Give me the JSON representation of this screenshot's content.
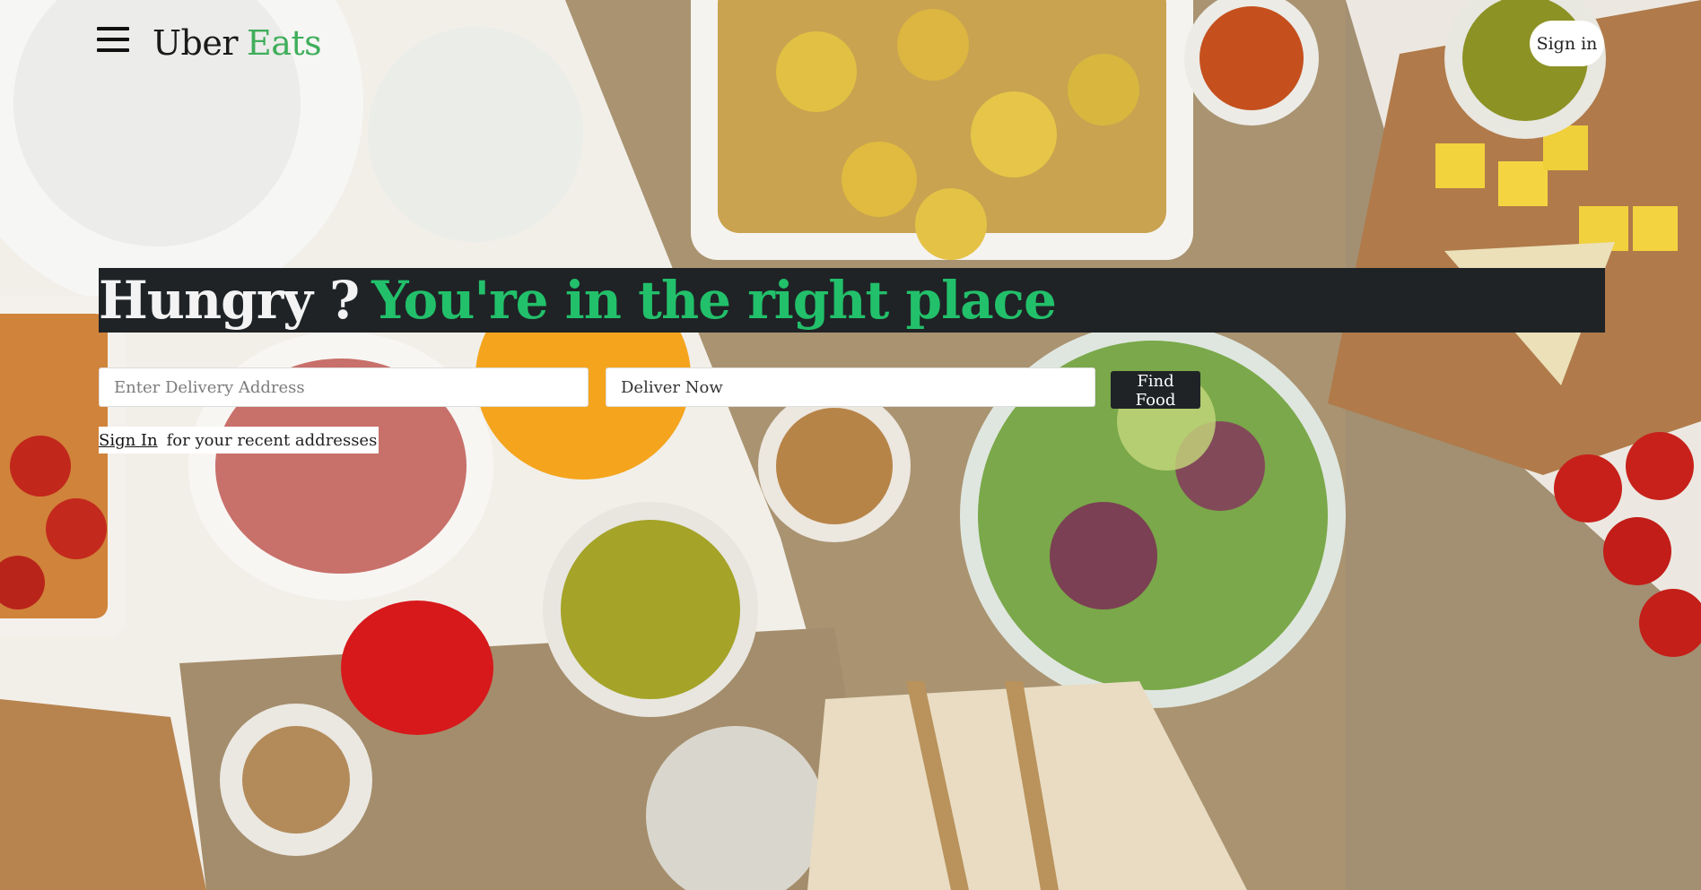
{
  "header": {
    "menu_icon": "hamburger-icon",
    "logo_word1": "Uber",
    "logo_word2": "Eats",
    "signin_label": "Sign in"
  },
  "hero": {
    "title_part1": "Hungry ?",
    "title_part2": "You're in the right place"
  },
  "search": {
    "address_placeholder": "Enter Delivery Address",
    "address_value": "",
    "delivery_time_value": "Deliver Now",
    "find_button_label": "Find Food"
  },
  "recent": {
    "signin_link": "Sign In",
    "suffix_text": "for your recent addresses"
  },
  "colors": {
    "brand_green": "#3fae5b",
    "hero_green": "#22c06a",
    "dark": "#1f2326"
  }
}
